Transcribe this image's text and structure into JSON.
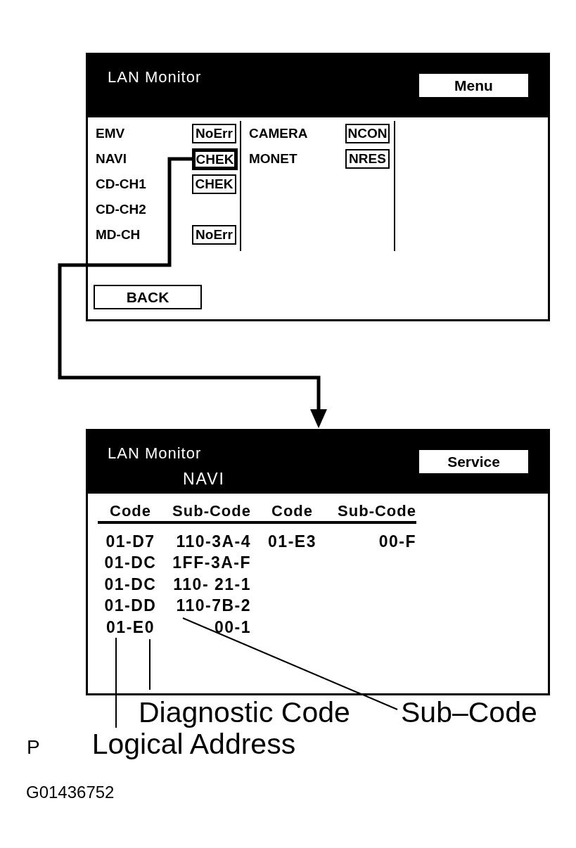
{
  "menu_screen": {
    "title": "LAN Monitor",
    "button": "Menu",
    "columns": [
      {
        "devices": [
          {
            "name": "EMV",
            "status": "NoErr",
            "selected": false
          },
          {
            "name": "NAVI",
            "status": "CHEK",
            "selected": true
          },
          {
            "name": "CD-CH1",
            "status": "CHEK",
            "selected": false
          },
          {
            "name": "CD-CH2",
            "selected": false
          },
          {
            "name": "MD-CH",
            "status": "NoErr",
            "selected": false
          }
        ]
      },
      {
        "devices": [
          {
            "name": "CAMERA",
            "status": "NCON",
            "selected": false
          },
          {
            "name": "MONET",
            "status": "NRES",
            "selected": false
          }
        ]
      }
    ],
    "back_button": "BACK"
  },
  "service_screen": {
    "title": "LAN Monitor",
    "subtitle": "NAVI",
    "button": "Service",
    "table": {
      "columns": [
        "Code",
        "Sub-Code",
        "Code",
        "Sub-Code"
      ],
      "rows": [
        [
          "01-D7",
          "110-3A-4",
          "01-E3",
          "00-F"
        ],
        [
          "01-DC",
          "1FF-3A-F"
        ],
        [
          "01-DC",
          "110- 21-1"
        ],
        [
          "01-DD",
          "110-7B-2"
        ],
        [
          "01-E0",
          "00-1"
        ]
      ]
    }
  },
  "callouts": [
    {
      "label": "Diagnostic Code"
    },
    {
      "label": "Sub–Code"
    },
    {
      "label": "Logical Address"
    }
  ],
  "figure_letter": "P",
  "figure_number": "G01436752"
}
